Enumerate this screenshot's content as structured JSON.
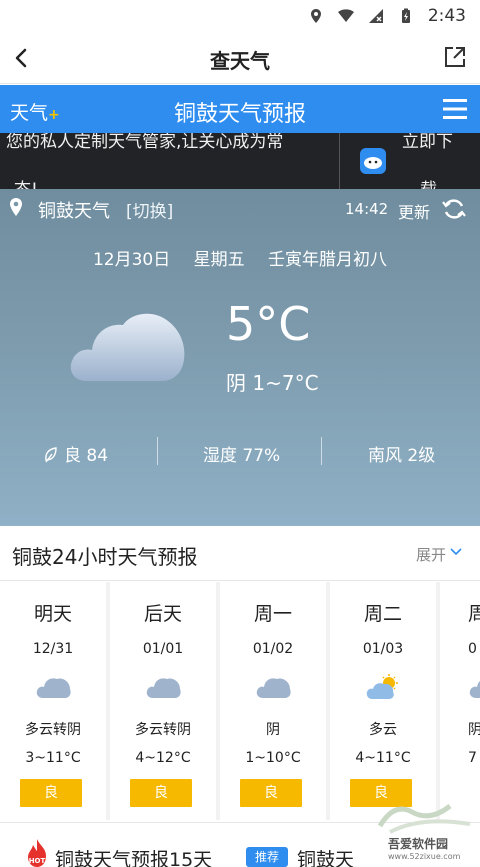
{
  "status_bar": {
    "time": "2:43"
  },
  "app_bar": {
    "title": "查天气"
  },
  "blue_bar": {
    "logo": "天气",
    "logo_plus": "+",
    "title": "铜鼓天气预报"
  },
  "banner": {
    "line1": "您的私人定制天气管家,让关心成为常",
    "line2": "态!",
    "line3": "立即下",
    "line4": "载"
  },
  "current": {
    "city": "铜鼓天气",
    "switch_label": "[切换]",
    "update_time": "14:42",
    "update_label": "更新",
    "date": "12月30日",
    "weekday": "星期五",
    "lunar": "壬寅年腊月初八",
    "temperature": "5°C",
    "condition_range": "阴 1~7°C",
    "aqi": "良 84",
    "humidity": "湿度 77%",
    "wind": "南风 2级"
  },
  "hourly": {
    "title": "铜鼓24小时天气预报",
    "expand_label": "展开"
  },
  "forecast": [
    {
      "day": "明天",
      "date": "12/31",
      "icon": "cloudy-icon",
      "condition": "多云转阴",
      "range": "3~11°C",
      "aqi": "良"
    },
    {
      "day": "后天",
      "date": "01/01",
      "icon": "cloudy-icon",
      "condition": "多云转阴",
      "range": "4~12°C",
      "aqi": "良"
    },
    {
      "day": "周一",
      "date": "01/02",
      "icon": "cloudy-icon",
      "condition": "阴",
      "range": "1~10°C",
      "aqi": "良"
    },
    {
      "day": "周二",
      "date": "01/03",
      "icon": "partly-sunny-icon",
      "condition": "多云",
      "range": "4~11°C",
      "aqi": "良"
    },
    {
      "day": "周",
      "date": "0",
      "icon": "cloudy-icon",
      "condition": "阴",
      "range": "7",
      "aqi": ""
    }
  ],
  "bottom": {
    "title": "铜鼓天气预报15天",
    "badge": "推荐",
    "title2": "铜鼓天"
  },
  "watermark": {
    "brand": "吾爱软件园",
    "url": "www.52zixue.com"
  },
  "colors": {
    "blue": "#2f8df0",
    "aqi_yellow": "#f6b900",
    "banner_bg": "#222326"
  }
}
